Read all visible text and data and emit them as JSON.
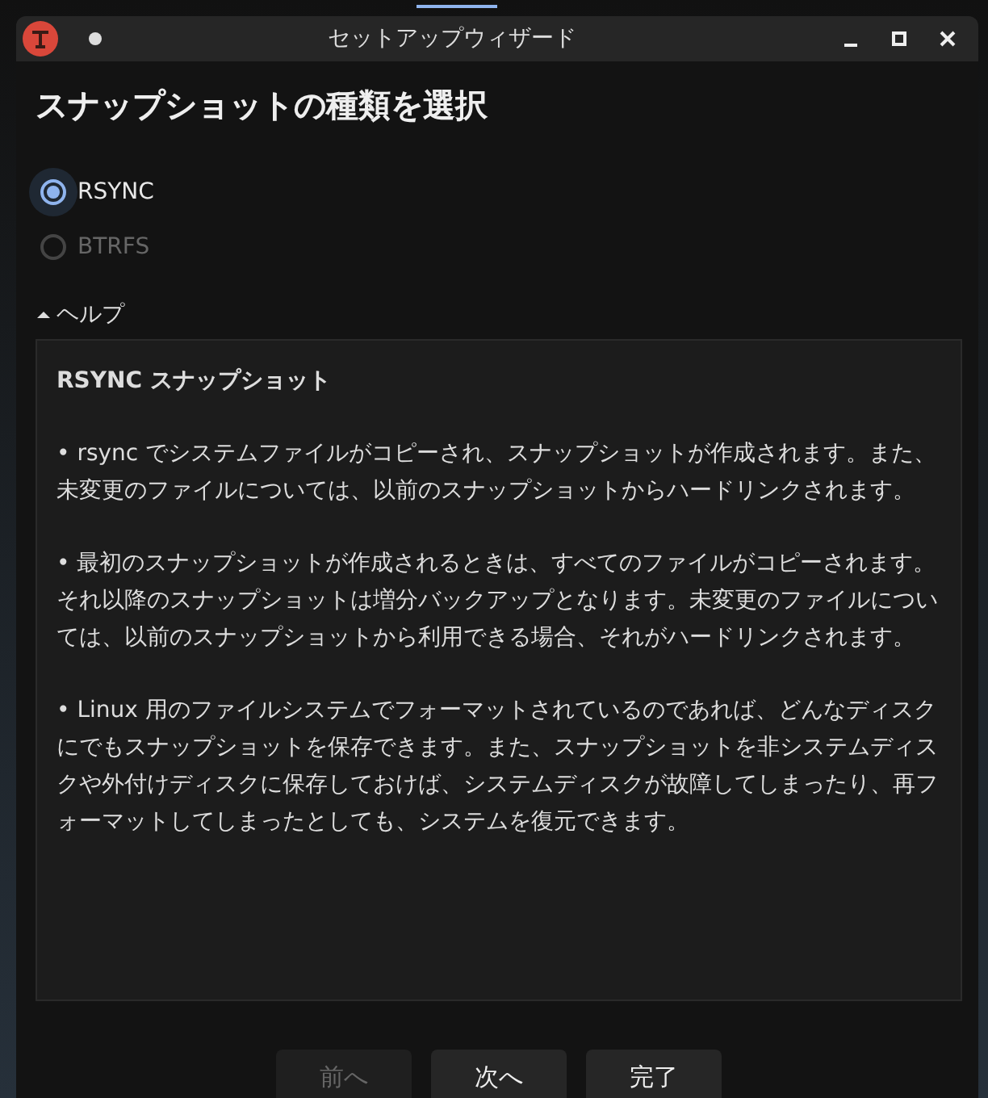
{
  "window": {
    "title": "セットアップウィザード"
  },
  "heading": "スナップショットの種類を選択",
  "options": [
    {
      "label": "RSYNC",
      "selected": true,
      "disabled": false
    },
    {
      "label": "BTRFS",
      "selected": false,
      "disabled": true
    }
  ],
  "help": {
    "label": "ヘルプ",
    "expanded": true,
    "title": "RSYNC スナップショット",
    "paragraphs": [
      "• rsync でシステムファイルがコピーされ、スナップショットが作成されます。また、未変更のファイルについては、以前のスナップショットからハードリンクされます。",
      "• 最初のスナップショットが作成されるときは、すべてのファイルがコピーされます。それ以降のスナップショットは増分バックアップとなります。未変更のファイルについては、以前のスナップショットから利用できる場合、それがハードリンクされます。",
      "• Linux 用のファイルシステムでフォーマットされているのであれば、どんなディスクにでもスナップショットを保存できます。また、スナップショットを非システムディスクや外付けディスクに保存しておけば、システムディスクが故障してしまったり、再フォーマットしてしまったとしても、システムを復元できます。"
    ]
  },
  "buttons": [
    {
      "label": "前へ",
      "disabled": true
    },
    {
      "label": "次へ",
      "disabled": false
    },
    {
      "label": "完了",
      "disabled": false
    }
  ]
}
